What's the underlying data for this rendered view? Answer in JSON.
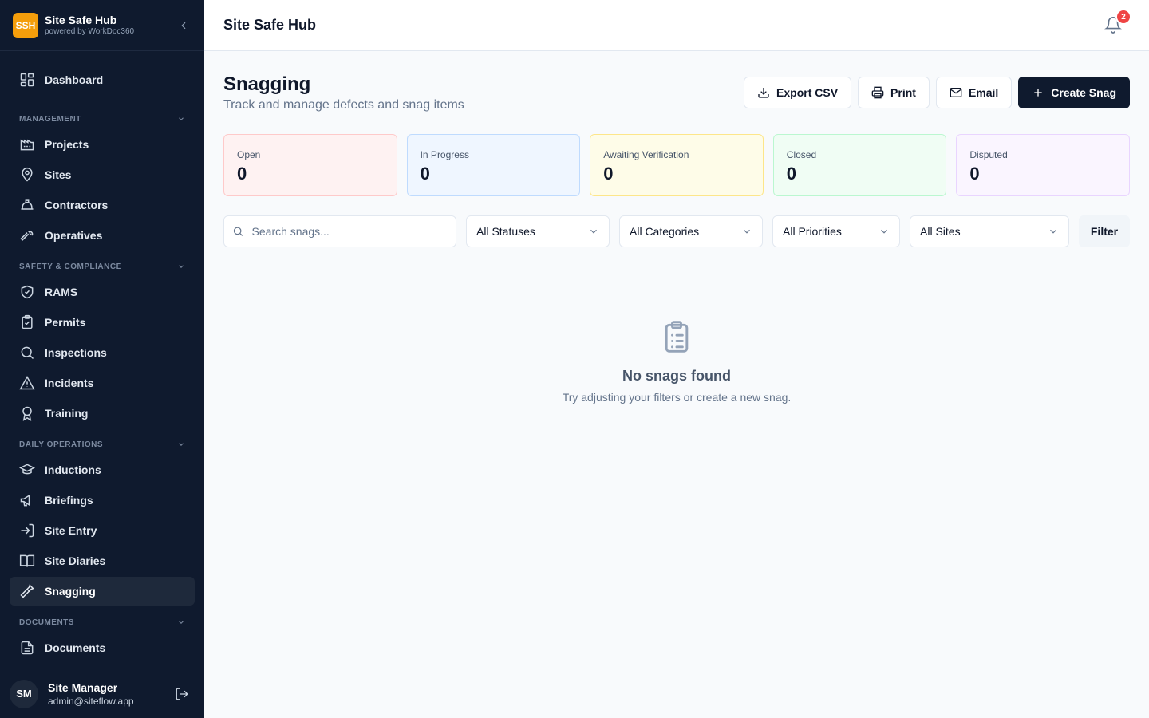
{
  "brand": {
    "logo_text": "SSH",
    "name": "Site Safe Hub",
    "tagline": "powered by WorkDoc360"
  },
  "sidebar": {
    "dashboard": "Dashboard",
    "sections": {
      "management": "MANAGEMENT",
      "safety": "SAFETY & COMPLIANCE",
      "daily": "DAILY OPERATIONS",
      "documents": "DOCUMENTS"
    },
    "items": {
      "projects": "Projects",
      "sites": "Sites",
      "contractors": "Contractors",
      "operatives": "Operatives",
      "rams": "RAMS",
      "permits": "Permits",
      "inspections": "Inspections",
      "incidents": "Incidents",
      "training": "Training",
      "inductions": "Inductions",
      "briefings": "Briefings",
      "site_entry": "Site Entry",
      "site_diaries": "Site Diaries",
      "snagging": "Snagging",
      "documents": "Documents"
    },
    "active": "snagging"
  },
  "user": {
    "initials": "SM",
    "name": "Site Manager",
    "email": "admin@siteflow.app"
  },
  "topbar": {
    "title": "Site Safe Hub",
    "notification_count": "2"
  },
  "page": {
    "title": "Snagging",
    "subtitle": "Track and manage defects and snag items"
  },
  "actions": {
    "export": "Export CSV",
    "print": "Print",
    "email": "Email",
    "create": "Create Snag"
  },
  "stats": [
    {
      "label": "Open",
      "value": "0",
      "bg": "#fef2f2",
      "border": "#fecaca"
    },
    {
      "label": "In Progress",
      "value": "0",
      "bg": "#eff6ff",
      "border": "#bfdbfe"
    },
    {
      "label": "Awaiting Verification",
      "value": "0",
      "bg": "#fefce8",
      "border": "#fde68a"
    },
    {
      "label": "Closed",
      "value": "0",
      "bg": "#f0fdf4",
      "border": "#bbf7d0"
    },
    {
      "label": "Disputed",
      "value": "0",
      "bg": "#faf5ff",
      "border": "#e9d5ff"
    }
  ],
  "filters": {
    "search_placeholder": "Search snags...",
    "status": "All Statuses",
    "category": "All Categories",
    "priority": "All Priorities",
    "site": "All Sites",
    "filter_button": "Filter"
  },
  "empty": {
    "title": "No snags found",
    "message": "Try adjusting your filters or create a new snag."
  }
}
